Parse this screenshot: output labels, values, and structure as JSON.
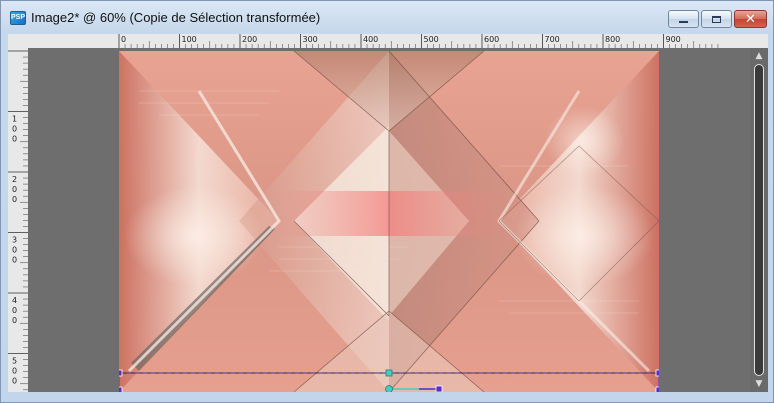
{
  "window": {
    "title": "Image2* @  60% (Copie de Sélection transformée)",
    "app_icon": "psp-image-icon",
    "controls": {
      "minimize_icon": "minimize-icon",
      "maximize_icon": "maximize-icon",
      "close_glyph": "✕"
    }
  },
  "rulers": {
    "top_labels": [
      "0",
      "100",
      "200",
      "300",
      "400",
      "500",
      "600",
      "700",
      "800",
      "900"
    ],
    "left_labels": [
      "1 0 0",
      "2 0 0",
      "3 0 0",
      "4 0 0",
      "5 0 0"
    ]
  },
  "zoom_percent": 60,
  "colors": {
    "image_base": "#e7a090",
    "image_highlight": "#fbeee2",
    "image_shadow": "#9a6d5c",
    "selection_line": "#5a2ccc",
    "handle_teal": "#3fd0c0"
  },
  "scrollbar": {
    "up_glyph": "▲",
    "down_glyph": "▼"
  }
}
